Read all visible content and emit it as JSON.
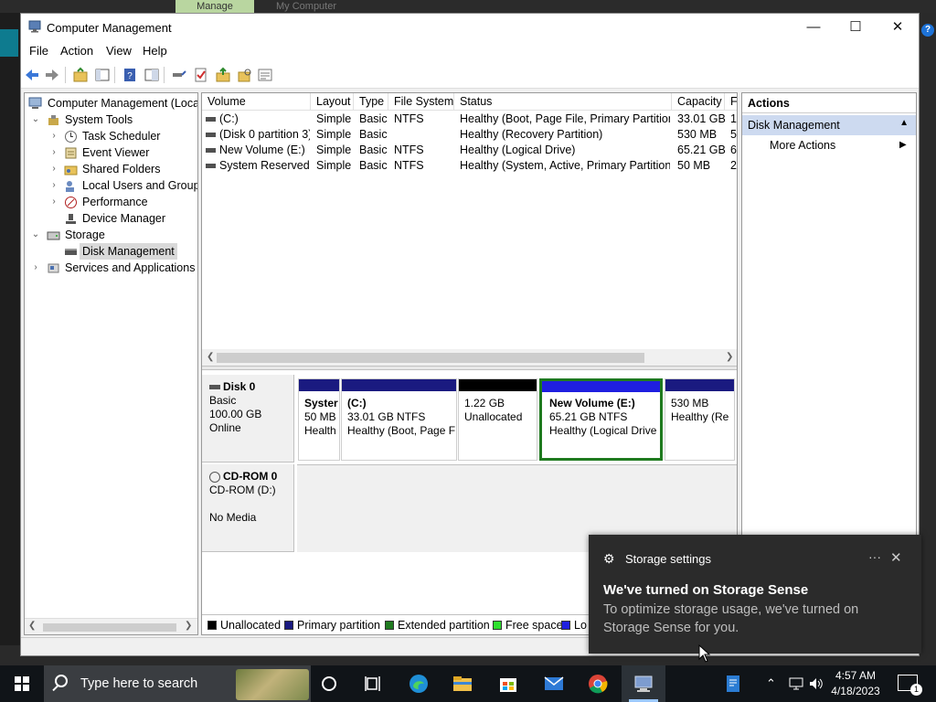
{
  "background": {
    "tab_active": "Manage",
    "tab_other": "My Computer"
  },
  "window": {
    "title": "Computer Management",
    "minimize": "—",
    "maximize": "☐",
    "close": "✕"
  },
  "menu": [
    "File",
    "Action",
    "View",
    "Help"
  ],
  "tree": {
    "root": "Computer Management (Local",
    "system_tools": "System Tools",
    "task_scheduler": "Task Scheduler",
    "event_viewer": "Event Viewer",
    "shared_folders": "Shared Folders",
    "local_users": "Local Users and Groups",
    "performance": "Performance",
    "device_manager": "Device Manager",
    "storage": "Storage",
    "disk_management": "Disk Management",
    "services": "Services and Applications"
  },
  "volumes": {
    "columns": [
      "Volume",
      "Layout",
      "Type",
      "File System",
      "Status",
      "Capacity",
      "F"
    ],
    "rows": [
      {
        "volume": "(C:)",
        "layout": "Simple",
        "type": "Basic",
        "fs": "NTFS",
        "status": "Healthy (Boot, Page File, Primary Partition)",
        "capacity": "33.01 GB",
        "free": "1"
      },
      {
        "volume": "(Disk 0 partition 3)",
        "layout": "Simple",
        "type": "Basic",
        "fs": "",
        "status": "Healthy (Recovery Partition)",
        "capacity": "530 MB",
        "free": "5"
      },
      {
        "volume": "New Volume (E:)",
        "layout": "Simple",
        "type": "Basic",
        "fs": "NTFS",
        "status": "Healthy (Logical Drive)",
        "capacity": "65.21 GB",
        "free": "6"
      },
      {
        "volume": "System Reserved",
        "layout": "Simple",
        "type": "Basic",
        "fs": "NTFS",
        "status": "Healthy (System, Active, Primary Partition)",
        "capacity": "50 MB",
        "free": "2"
      }
    ]
  },
  "disk0": {
    "name": "Disk 0",
    "type": "Basic",
    "size": "100.00 GB",
    "state": "Online",
    "partitions": [
      {
        "l1": "Syster",
        "l2": "50 MB",
        "l3": "Health",
        "bar": "#1a1a80"
      },
      {
        "l1": "(C:)",
        "l2": "33.01 GB NTFS",
        "l3": "Healthy (Boot, Page F",
        "bar": "#1a1a80"
      },
      {
        "l1": "",
        "l2": "1.22 GB",
        "l3": "Unallocated",
        "bar": "#000000"
      },
      {
        "l1": "New Volume  (E:)",
        "l2": "65.21 GB NTFS",
        "l3": "Healthy (Logical Drive",
        "bar": "#1f1fe0"
      },
      {
        "l1": "",
        "l2": "530 MB",
        "l3": "Healthy (Re",
        "bar": "#1a1a80"
      }
    ]
  },
  "cdrom": {
    "name": "CD-ROM 0",
    "type": "CD-ROM (D:)",
    "state": "No Media"
  },
  "legend": [
    {
      "label": "Unallocated",
      "color": "#000000"
    },
    {
      "label": "Primary partition",
      "color": "#1a1a80"
    },
    {
      "label": "Extended partition",
      "color": "#1f7a1f"
    },
    {
      "label": "Free space",
      "color": "#30e030"
    },
    {
      "label": "Lo",
      "color": "#1f1fe0"
    }
  ],
  "actions": {
    "header": "Actions",
    "section": "Disk Management",
    "item": "More Actions"
  },
  "toast": {
    "app": "Storage settings",
    "more": "···",
    "close": "✕",
    "title": "We've turned on Storage Sense",
    "body": "To optimize storage usage, we've turned on Storage Sense for you."
  },
  "taskbar": {
    "search_placeholder": "Type here to search",
    "time": "4:57 AM",
    "date": "4/18/2023",
    "notification_count": "1"
  }
}
